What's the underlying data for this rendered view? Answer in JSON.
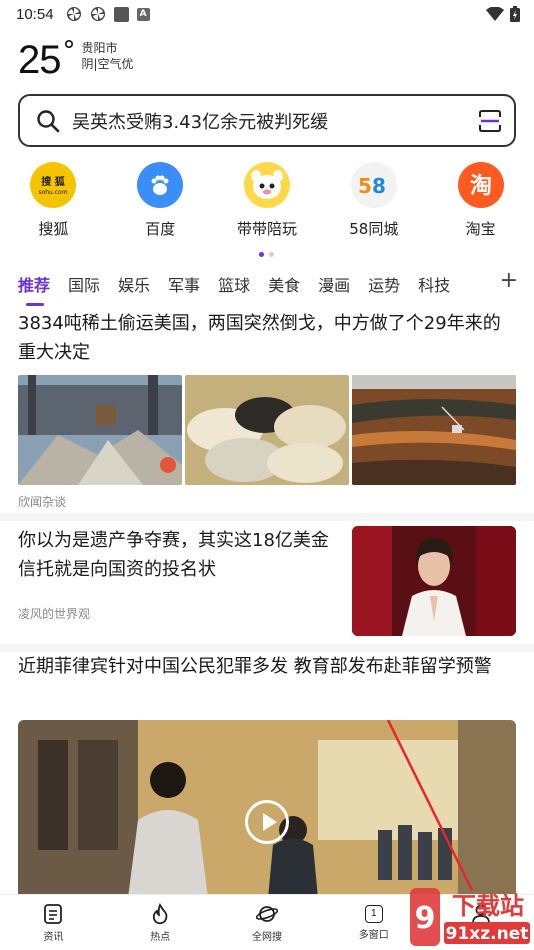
{
  "status_bar": {
    "time": "10:54"
  },
  "weather": {
    "temperature": "25",
    "degree": "°",
    "city": "贵阳市",
    "condition": "阴|空气优"
  },
  "search": {
    "query": "吴英杰受贿3.43亿余元被判死缓"
  },
  "shortcuts": [
    {
      "label": "搜狐",
      "icon": "sohu-icon",
      "color": "#f5c400"
    },
    {
      "label": "百度",
      "icon": "baidu-icon",
      "color": "#3a8ef5"
    },
    {
      "label": "带带陪玩",
      "icon": "daidai-icon",
      "color": "#ffd84a"
    },
    {
      "label": "58同城",
      "icon": "58-icon",
      "color": "#f2f2f2"
    },
    {
      "label": "淘宝",
      "icon": "taobao-icon",
      "color": "#ff5a1f"
    }
  ],
  "tabs": {
    "items": [
      "推荐",
      "国际",
      "娱乐",
      "军事",
      "篮球",
      "美食",
      "漫画",
      "运势",
      "科技"
    ],
    "plus": "+"
  },
  "feed": {
    "article1": {
      "title": "3834吨稀土偷运美国，两国突然倒戈，中方做了个29年来的重大决定",
      "source": "欣闻杂谈"
    },
    "article2": {
      "title": "你以为是遗产争夺赛，其实这18亿美金信托就是向国资的投名状",
      "source": "凌风的世界观"
    },
    "article3": {
      "title": "近期菲律宾针对中国公民犯罪多发 教育部发布赴菲留学预警"
    }
  },
  "bottom_nav": [
    {
      "label": "资讯",
      "icon": "news-icon"
    },
    {
      "label": "热点",
      "icon": "flame-icon"
    },
    {
      "label": "全网搜",
      "icon": "planet-icon"
    },
    {
      "label": "多窗口",
      "icon": "window-icon",
      "badge": "1"
    },
    {
      "label": "我的",
      "icon": "user-icon"
    }
  ],
  "watermark": {
    "text": "下载站",
    "url_text": "91xz.net"
  },
  "colors": {
    "accent": "#6a33d6",
    "text": "#1a1a1a",
    "muted": "#888888"
  }
}
